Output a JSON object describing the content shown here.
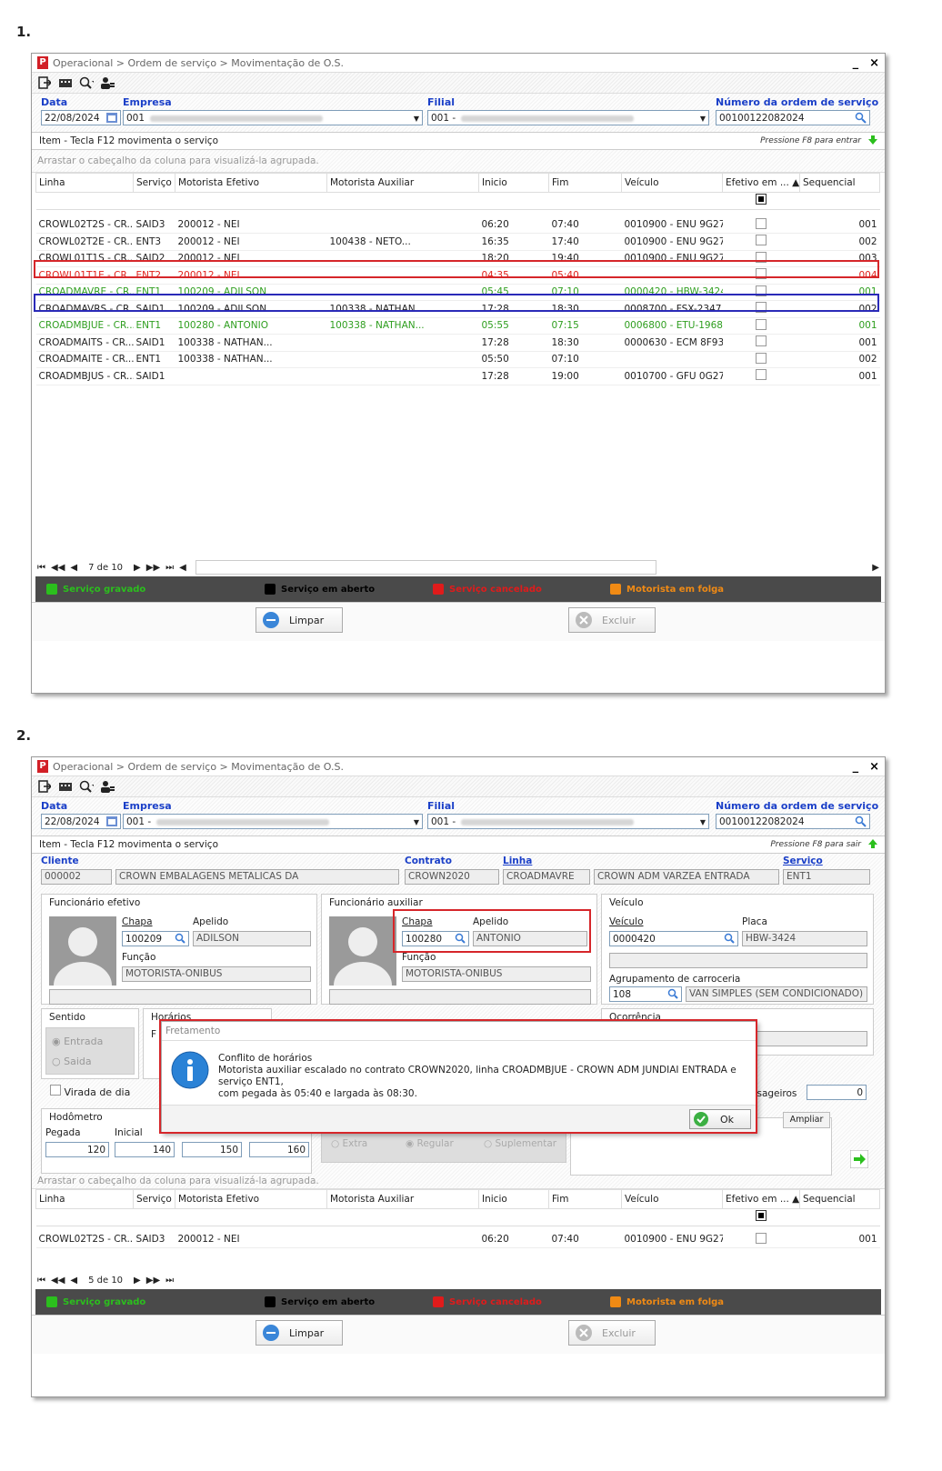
{
  "steps": [
    "1.",
    "2."
  ],
  "window": {
    "breadcrumb": "Operacional > Ordem de serviço > Movimentação de O.S.",
    "logo": "P",
    "minimize": "_",
    "close": "×"
  },
  "toolbar_icons": [
    "exit-icon",
    "keyboard-icon",
    "search-icon",
    "user-icon"
  ],
  "header": {
    "data_label": "Data",
    "data_value": "22/08/2024",
    "empresa_label": "Empresa",
    "empresa_value": "001",
    "empresa_value2": "001 -",
    "filial_label": "Filial",
    "filial_value": "001 -",
    "os_label": "Número da ordem de serviço",
    "os_value": "00100122082024"
  },
  "section": {
    "title": "Item - Tecla F12 movimenta o serviço",
    "hint_enter": "Pressione F8 para entrar",
    "hint_exit": "Pressione F8 para sair"
  },
  "group_hint": "Arrastar o cabeçalho da coluna para visualizá-la agrupada.",
  "grid": {
    "columns": [
      "Linha",
      "Serviço",
      "Motorista Efetivo",
      "Motorista Auxiliar",
      "Inicio",
      "Fim",
      "Veículo",
      "Efetivo em ...",
      "Sequencial"
    ],
    "rows": [
      {
        "linha": "CROWL02T2S - CR...",
        "servico": "SAID3",
        "efetivo": "200012 - NEI",
        "auxiliar": "",
        "inicio": "06:20",
        "fim": "07:40",
        "veiculo": "0010900 - ENU 9G27",
        "seq": "001",
        "status": "open"
      },
      {
        "linha": "CROWL02T2E - CR...",
        "servico": "ENT3",
        "efetivo": "200012 - NEI",
        "auxiliar": "100438 - NETO...",
        "inicio": "16:35",
        "fim": "17:40",
        "veiculo": "0010900 - ENU 9G27",
        "seq": "002",
        "status": "open"
      },
      {
        "linha": "CROWL01T1S - CR...",
        "servico": "SAID2",
        "efetivo": "200012 - NEI",
        "auxiliar": "",
        "inicio": "18:20",
        "fim": "19:40",
        "veiculo": "0010900 - ENU 9G27",
        "seq": "003",
        "status": "open"
      },
      {
        "linha": "CROWL01T1E - CR...",
        "servico": "ENT2",
        "efetivo": "200012 - NEI",
        "auxiliar": "",
        "inicio": "04:35",
        "fim": "05:40",
        "veiculo": "",
        "seq": "004",
        "status": "cancel"
      },
      {
        "linha": "CROADMAVRE - CR...",
        "servico": "ENT1",
        "efetivo": "100209 - ADILSON",
        "auxiliar": "",
        "inicio": "05:45",
        "fim": "07:10",
        "veiculo": "0000420 - HBW-3424",
        "seq": "001",
        "status": "saved"
      },
      {
        "linha": "CROADMAVRS - CR...",
        "servico": "SAID1",
        "efetivo": "100209 - ADILSON",
        "auxiliar": "100338 - NATHAN...",
        "inicio": "17:28",
        "fim": "18:30",
        "veiculo": "0008700 - FSX-2347",
        "seq": "002",
        "status": "open"
      },
      {
        "linha": "CROADMBJUE - CR...",
        "servico": "ENT1",
        "efetivo": "100280 - ANTONIO",
        "auxiliar": "100338 - NATHAN...",
        "inicio": "05:55",
        "fim": "07:15",
        "veiculo": "0006800 - ETU-1968",
        "seq": "001",
        "status": "saved"
      },
      {
        "linha": "CROADMAITS - CR...",
        "servico": "SAID1",
        "efetivo": "100338 - NATHAN...",
        "auxiliar": "",
        "inicio": "17:28",
        "fim": "18:30",
        "veiculo": "0000630 - ECM 8F93",
        "seq": "001",
        "status": "open"
      },
      {
        "linha": "CROADMAITE - CR...",
        "servico": "ENT1",
        "efetivo": "100338 - NATHAN...",
        "auxiliar": "",
        "inicio": "05:50",
        "fim": "07:10",
        "veiculo": "",
        "seq": "002",
        "status": "open"
      },
      {
        "linha": "CROADMBJUS - CR...",
        "servico": "SAID1",
        "efetivo": "",
        "auxiliar": "",
        "inicio": "17:28",
        "fim": "19:00",
        "veiculo": "0010700 - GFU 0G27",
        "seq": "001",
        "status": "open"
      }
    ]
  },
  "nav": {
    "pos1": "7 de 10",
    "pos2": "5 de 10",
    "first": "⏮",
    "prev_page": "◀◀",
    "prev": "◀",
    "next": "▶",
    "next_page": "▶▶",
    "last": "⏭"
  },
  "legend": [
    {
      "label": "Serviço gravado",
      "color": "#2bbf1d"
    },
    {
      "label": "Serviço em aberto",
      "color": "#000000"
    },
    {
      "label": "Serviço cancelado",
      "color": "#e01b1b"
    },
    {
      "label": "Motorista em folga",
      "color": "#f08a14"
    }
  ],
  "buttons": {
    "limpar": "Limpar",
    "excluir": "Excluir"
  },
  "detail": {
    "cliente_label": "Cliente",
    "cliente_code": "000002",
    "cliente_name": "CROWN EMBALAGENS METALICAS DA",
    "contrato_label": "Contrato",
    "contrato_value": "CROWN2020",
    "linha_label": "Linha",
    "linha_code": "CROADMAVRE",
    "linha_name": "CROWN ADM VARZEA ENTRADA",
    "servico_label": "Serviço",
    "servico_value": "ENT1",
    "efetivo_title": "Funcionário efetivo",
    "aux_title": "Funcionário auxiliar",
    "chapa_label": "Chapa",
    "apelido_label": "Apelido",
    "funcao_label": "Função",
    "efetivo_chapa": "100209",
    "efetivo_apelido": "ADILSON",
    "efetivo_funcao": "MOTORISTA-ONIBUS",
    "aux_chapa": "100280",
    "aux_apelido": "ANTONIO",
    "aux_funcao": "MOTORISTA-ONIBUS",
    "veiculo_title": "Veículo",
    "veiculo_label": "Veículo",
    "veiculo_value": "0000420",
    "placa_label": "Placa",
    "placa_value": "HBW-3424",
    "agrup_label": "Agrupamento de carroceria",
    "agrup_code": "108",
    "agrup_name": "VAN SIMPLES (SEM CONDICIONADO)",
    "sentido_title": "Sentido",
    "entrada": "Entrada",
    "saida": "Saida",
    "horarios_title": "Horários",
    "horarios_frag": "F",
    "ocorrencia_title": "Ocorrência",
    "virada": "Virada de dia",
    "passageiros_label": "ssageiros",
    "passageiros_value": "0",
    "hodometro_title": "Hodômetro",
    "pegada_label": "Pegada",
    "inicial_label": "Inicial",
    "hod": [
      "120",
      "140",
      "150",
      "160"
    ],
    "extra": "Extra",
    "regular": "Regular",
    "suplementar": "Suplementar",
    "ampliar": "Ampliar"
  },
  "dialog": {
    "title": "Fretamento",
    "heading": "Conflito de horários",
    "line1": "Motorista auxiliar escalado no contrato CROWN2020, linha CROADMBJUE - CROWN ADM JUNDIAI ENTRADA e serviço ENT1,",
    "line2": "com pegada às 05:40 e largada às 08:30.",
    "ok": "Ok"
  }
}
